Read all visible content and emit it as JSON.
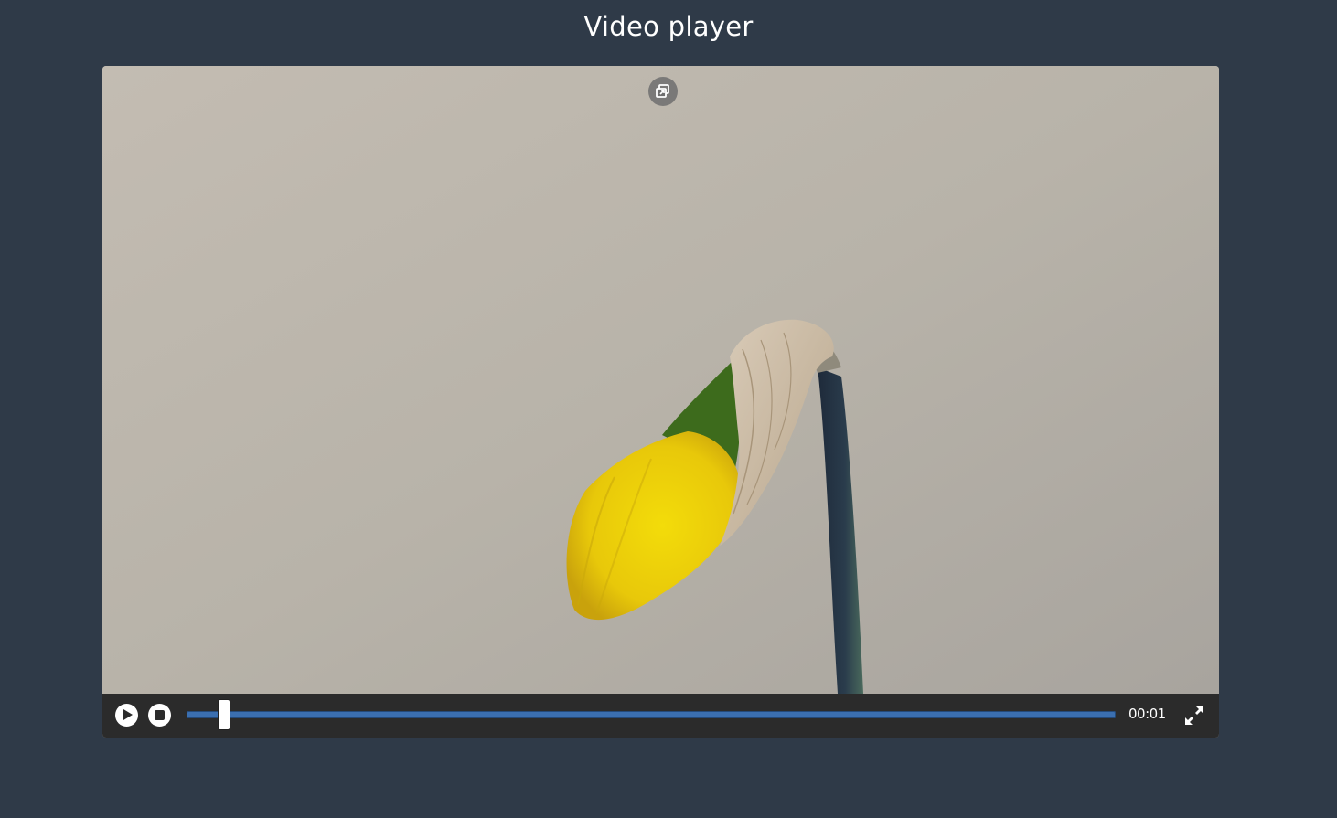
{
  "page": {
    "title": "Video player"
  },
  "player": {
    "pip_icon": "picture-in-picture-icon",
    "controls": {
      "play_icon": "play-icon",
      "stop_icon": "stop-icon",
      "fullscreen_icon": "fullscreen-icon",
      "time": "00:01",
      "progress_fraction": 0.04,
      "track_color": "#3b6fb0",
      "bar_color": "#2b2b2b"
    }
  },
  "colors": {
    "background": "#2f3a48",
    "title": "#ffffff"
  }
}
